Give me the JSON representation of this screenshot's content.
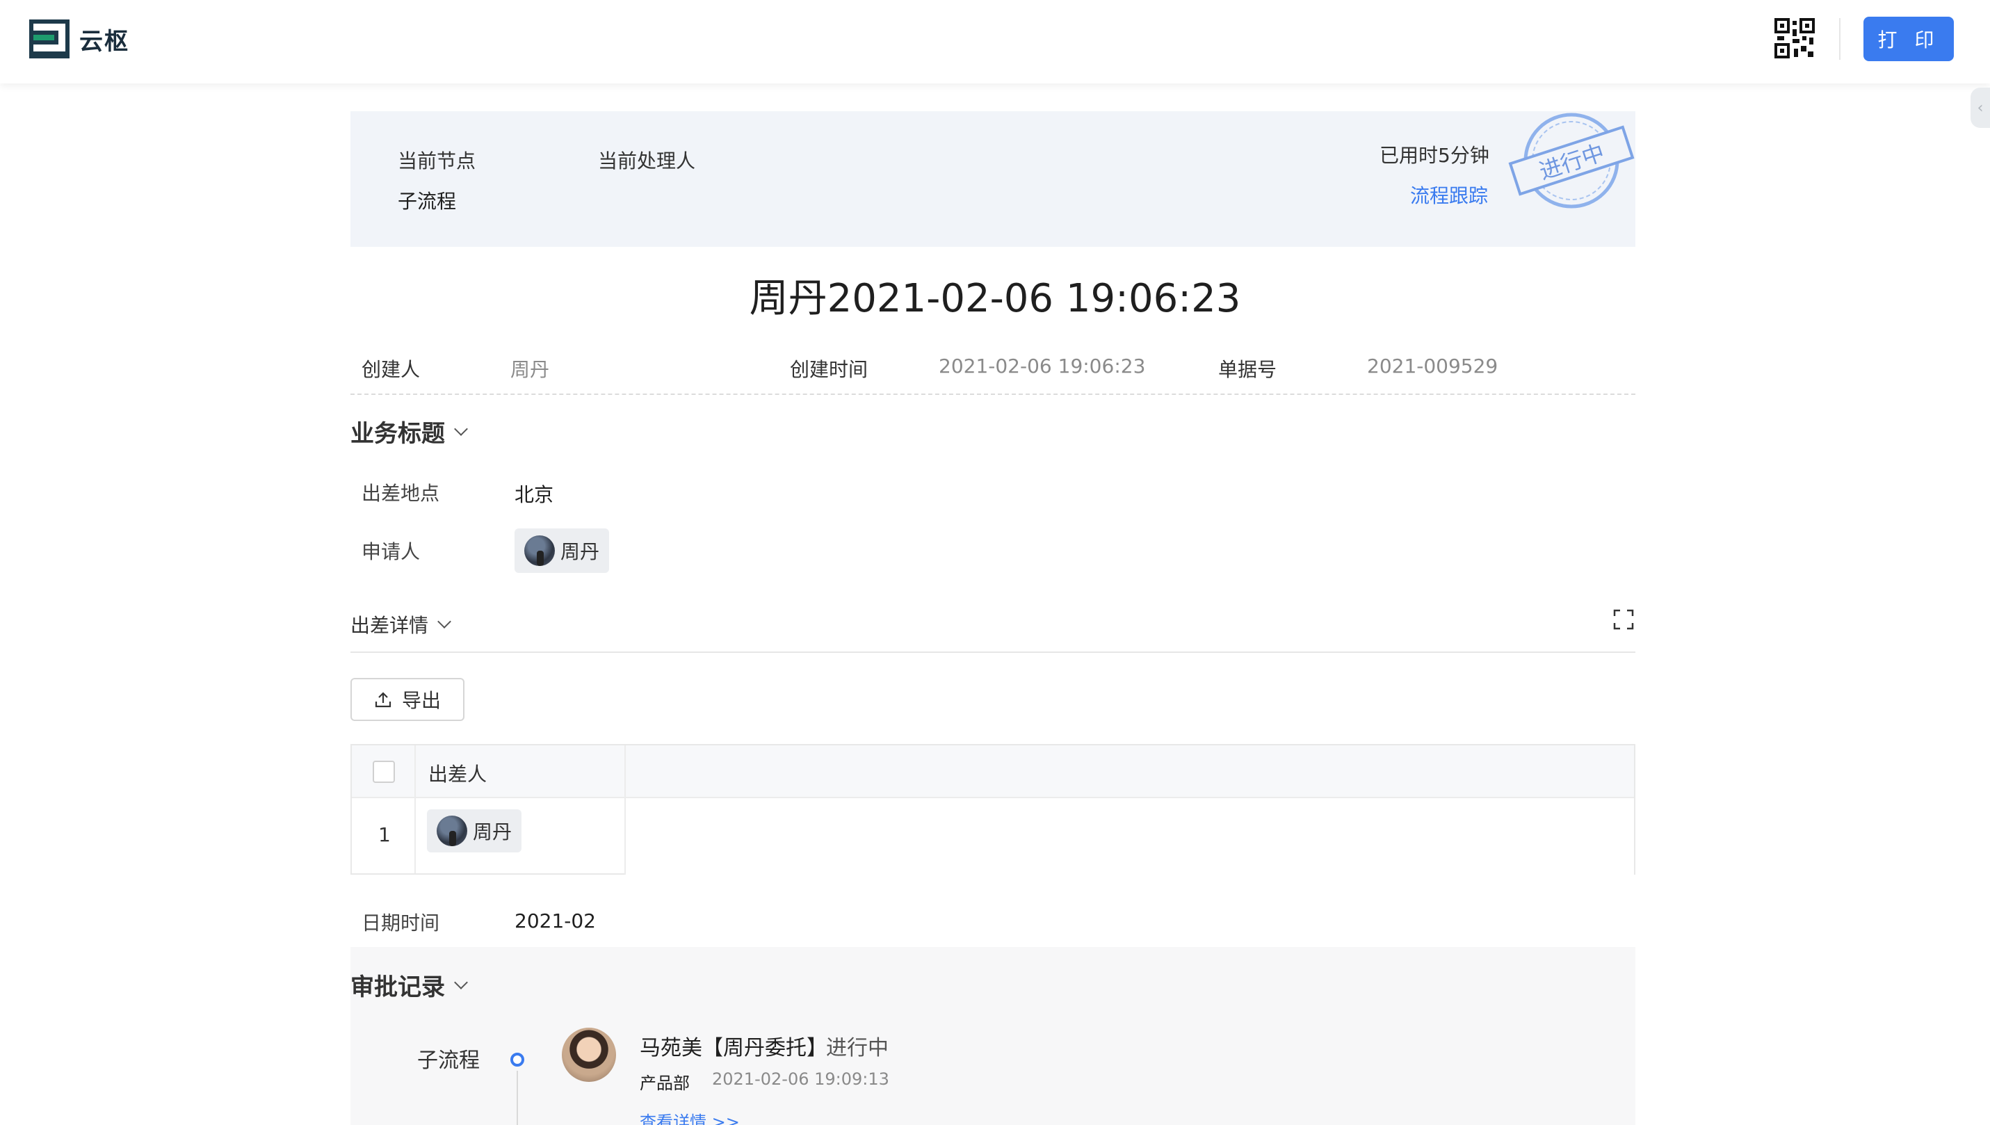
{
  "header": {
    "logo_text": "云枢",
    "print_label": "打 印",
    "brand_color": "#1e9c6e",
    "accent_color": "#3a7bef"
  },
  "status_panel": {
    "current_node_label": "当前节点",
    "current_node_value": "子流程",
    "current_handler_label": "当前处理人",
    "elapsed": "已用时5分钟",
    "trace_link": "流程跟踪",
    "stamp_text": "进行中"
  },
  "document": {
    "title": "周丹2021-02-06 19:06:23",
    "creator_label": "创建人",
    "creator_value": "周丹",
    "created_time_label": "创建时间",
    "created_time_value": "2021-02-06 19:06:23",
    "doc_no_label": "单据号",
    "doc_no_value": "2021-009529"
  },
  "business": {
    "section_title": "业务标题",
    "location_label": "出差地点",
    "location_value": "北京",
    "applicant_label": "申请人",
    "applicant_value": "周丹"
  },
  "trip_details": {
    "section_title": "出差详情",
    "export_label": "导出",
    "columns": [
      "出差人"
    ],
    "rows": [
      {
        "index": "1",
        "traveler": "周丹"
      }
    ],
    "date_label": "日期时间",
    "date_value": "2021-02"
  },
  "approval": {
    "section_title": "审批记录",
    "node": "子流程",
    "approver": "马苑美【周丹委托】",
    "status": "进行中",
    "department": "产品部",
    "time": "2021-02-06 19:09:13",
    "detail_link": "查看详情 >>"
  }
}
